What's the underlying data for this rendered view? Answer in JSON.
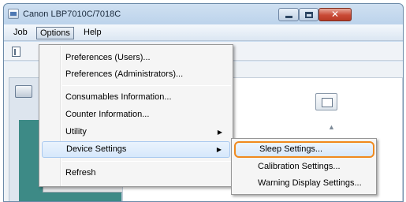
{
  "window": {
    "title": "Canon LBP7010C/7018C",
    "close_glyph": "✕"
  },
  "menubar": {
    "job": "Job",
    "options": "Options",
    "help": "Help"
  },
  "options_menu": {
    "preferences_users": "Preferences (Users)...",
    "preferences_admin": "Preferences (Administrators)...",
    "consumables": "Consumables Information...",
    "counter": "Counter Information...",
    "utility": "Utility",
    "device_settings": "Device Settings",
    "refresh": "Refresh",
    "submenu_arrow": "▶"
  },
  "device_settings_submenu": {
    "sleep": "Sleep Settings...",
    "calibration": "Calibration Settings...",
    "warning_display": "Warning Display Settings..."
  },
  "colors": {
    "highlight_outline": "#f08a1e",
    "close_button": "#c94a36"
  }
}
